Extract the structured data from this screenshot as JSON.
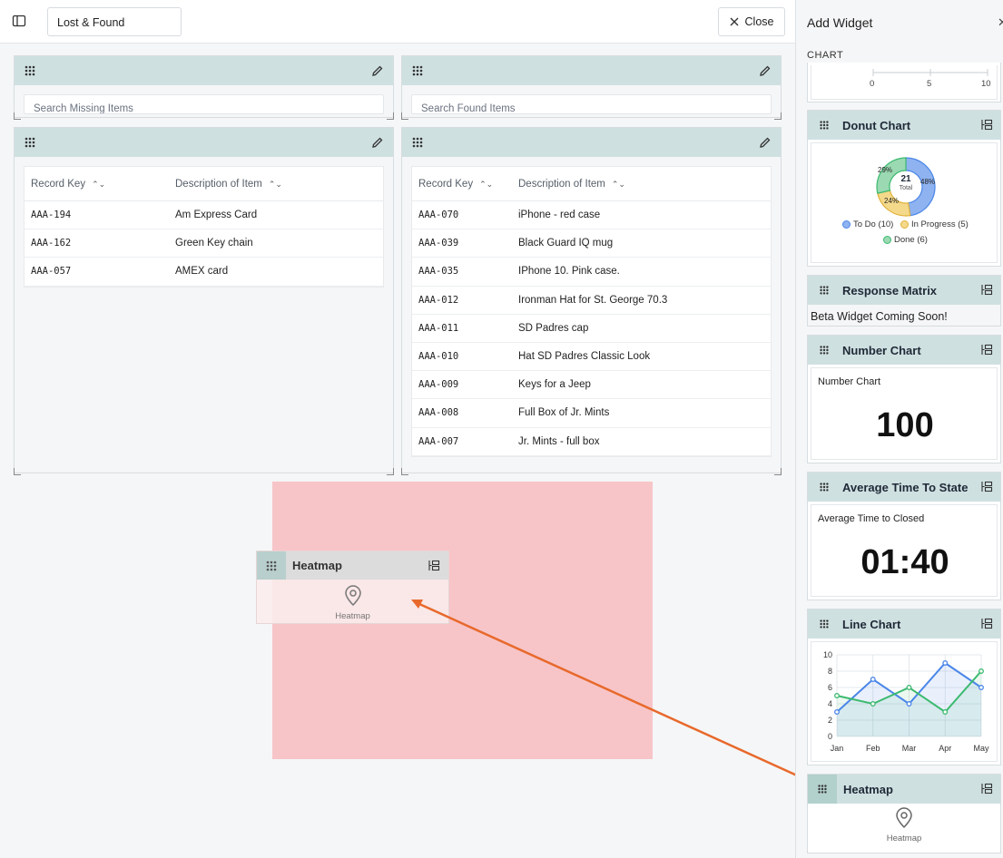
{
  "topbar": {
    "dashboard_name": "Lost & Found",
    "close_label": "Close"
  },
  "missing_widget": {
    "search_placeholder": "Search Missing Items",
    "columns": [
      "Record Key",
      "Description of Item"
    ],
    "rows": [
      {
        "key": "AAA-194",
        "desc": "Am Express Card"
      },
      {
        "key": "AAA-162",
        "desc": "Green Key chain"
      },
      {
        "key": "AAA-057",
        "desc": "AMEX card"
      }
    ]
  },
  "found_widget": {
    "search_placeholder": "Search Found Items",
    "columns": [
      "Record Key",
      "Description of Item"
    ],
    "rows": [
      {
        "key": "AAA-070",
        "desc": "iPhone - red case"
      },
      {
        "key": "AAA-039",
        "desc": "Black Guard IQ mug"
      },
      {
        "key": "AAA-035",
        "desc": "IPhone 10. Pink case."
      },
      {
        "key": "AAA-012",
        "desc": "Ironman Hat for St. George 70.3"
      },
      {
        "key": "AAA-011",
        "desc": "SD Padres cap"
      },
      {
        "key": "AAA-010",
        "desc": "Hat SD Padres Classic Look"
      },
      {
        "key": "AAA-009",
        "desc": "Keys for a Jeep"
      },
      {
        "key": "AAA-008",
        "desc": "Full Box of Jr. Mints"
      },
      {
        "key": "AAA-007",
        "desc": "Jr. Mints - full box"
      }
    ]
  },
  "drag_ghost": {
    "title": "Heatmap",
    "caption": "Heatmap"
  },
  "panel": {
    "title": "Add Widget",
    "section": "CHART",
    "top_axis_ticks": [
      "0",
      "5",
      "10"
    ],
    "donut": {
      "title": "Donut Chart",
      "center_value": "21",
      "center_label": "Total",
      "pct_labels": [
        "48%",
        "24%",
        "29%"
      ],
      "legend": [
        "To Do (10)",
        "In Progress (5)",
        "Done (6)"
      ]
    },
    "response_matrix": {
      "title": "Response Matrix",
      "body": "Beta Widget Coming Soon!"
    },
    "number_chart": {
      "title": "Number Chart",
      "subtitle": "Number Chart",
      "value": "100"
    },
    "avg_time": {
      "title": "Average Time To State",
      "subtitle": "Average Time to Closed",
      "value": "01:40"
    },
    "line_chart": {
      "title": "Line Chart"
    },
    "heatmap": {
      "title": "Heatmap",
      "caption": "Heatmap"
    }
  },
  "colors": {
    "header_teal": "#cfe0e1",
    "drop_zone": "#f7c5c8",
    "arrow": "#e8692c",
    "blue": "#4a86e8",
    "green": "#3cba6f",
    "yellow": "#f1c75b"
  },
  "chart_data": [
    {
      "type": "pie",
      "categories": [
        "To Do",
        "In Progress",
        "Done"
      ],
      "values": [
        10,
        5,
        6
      ],
      "total": 21
    },
    {
      "type": "line",
      "categories": [
        "Jan",
        "Feb",
        "Mar",
        "Apr",
        "May"
      ],
      "series": [
        {
          "values": [
            3,
            7,
            4,
            9,
            6
          ]
        },
        {
          "values": [
            5,
            4,
            6,
            3,
            8
          ]
        }
      ],
      "ylim": [
        0,
        10
      ],
      "yticks": [
        "0",
        "2",
        "4",
        "6",
        "8",
        "10"
      ]
    }
  ]
}
